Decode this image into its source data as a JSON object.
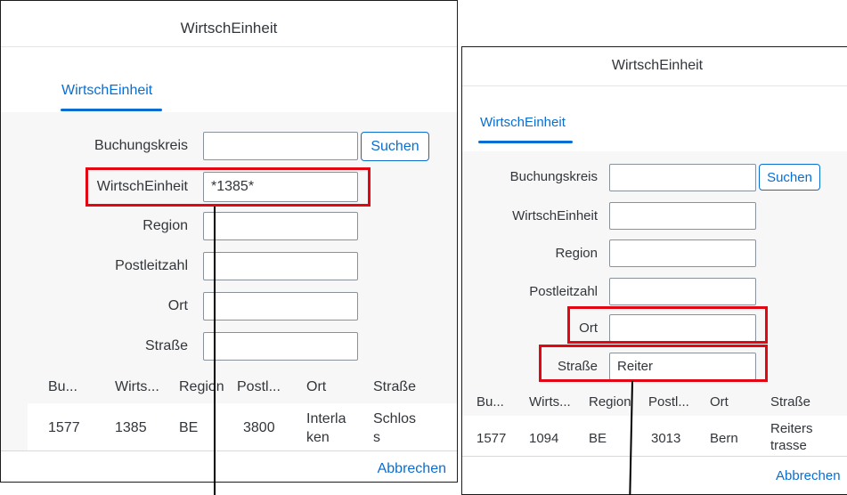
{
  "left_dialog": {
    "title": "WirtschEinheit",
    "tab_label": "WirtschEinheit",
    "fields": {
      "buchungskreis": {
        "label": "Buchungskreis",
        "value": ""
      },
      "wirtscheinheit": {
        "label": "WirtschEinheit",
        "value": "*1385*"
      },
      "region": {
        "label": "Region",
        "value": ""
      },
      "postleitzahl": {
        "label": "Postleitzahl",
        "value": ""
      },
      "ort": {
        "label": "Ort",
        "value": ""
      },
      "strasse": {
        "label": "Straße",
        "value": ""
      }
    },
    "search_button": "Suchen",
    "table": {
      "columns": [
        "Bu...",
        "Wirts...",
        "Region",
        "Postl...",
        "Ort",
        "Straße"
      ],
      "rows": [
        {
          "bu": "1577",
          "wirts": "1385",
          "region": "BE",
          "postl": "3800",
          "ort": "Interla\nken",
          "strasse": "Schlos\ns"
        }
      ]
    },
    "cancel_link": "Abbrechen"
  },
  "right_dialog": {
    "title": "WirtschEinheit",
    "tab_label": "WirtschEinheit",
    "fields": {
      "buchungskreis": {
        "label": "Buchungskreis",
        "value": ""
      },
      "wirtscheinheit": {
        "label": "WirtschEinheit",
        "value": ""
      },
      "region": {
        "label": "Region",
        "value": ""
      },
      "postleitzahl": {
        "label": "Postleitzahl",
        "value": ""
      },
      "ort": {
        "label": "Ort",
        "value": ""
      },
      "strasse": {
        "label": "Straße",
        "value": "Reiter"
      }
    },
    "search_button": "Suchen",
    "table": {
      "columns": [
        "Bu...",
        "Wirts...",
        "Region",
        "Postl...",
        "Ort",
        "Straße"
      ],
      "rows": [
        {
          "bu": "1577",
          "wirts": "1094",
          "region": "BE",
          "postl": "3013",
          "ort": "Bern",
          "strasse": "Reiters\ntrasse"
        }
      ]
    },
    "cancel_link": "Abbrechen"
  },
  "colors": {
    "accent": "#0a6ed1",
    "highlight": "#e30613",
    "content_bg": "#f7f7f7"
  }
}
